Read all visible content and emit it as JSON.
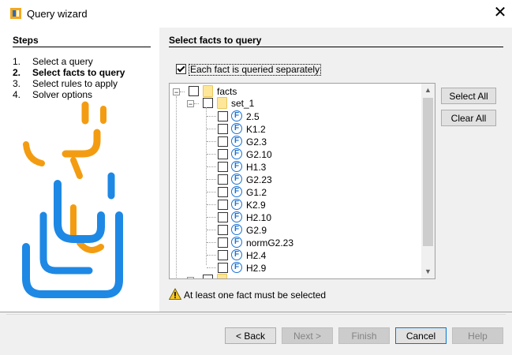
{
  "window": {
    "title": "Query wizard",
    "close_glyph": "✕"
  },
  "steps": {
    "title": "Steps",
    "items": [
      {
        "num": "1.",
        "label": "Select a query",
        "active": false
      },
      {
        "num": "2.",
        "label": "Select facts to query",
        "active": true
      },
      {
        "num": "3.",
        "label": "Select rules to apply",
        "active": false
      },
      {
        "num": "4.",
        "label": "Solver options",
        "active": false
      }
    ]
  },
  "main": {
    "title": "Select facts to query",
    "each_separately": {
      "label": "Each fact is queried separately",
      "checked": true
    },
    "tree": {
      "root": {
        "label": "facts",
        "checked": false,
        "expanded": true
      },
      "group": {
        "label": "set_1",
        "checked": false,
        "expanded": true
      },
      "facts": [
        {
          "label": "2.5",
          "checked": false
        },
        {
          "label": "K1.2",
          "checked": false
        },
        {
          "label": "G2.3",
          "checked": false
        },
        {
          "label": "G2.10",
          "checked": false
        },
        {
          "label": "H1.3",
          "checked": false
        },
        {
          "label": "G2.23",
          "checked": false
        },
        {
          "label": "G1.2",
          "checked": false
        },
        {
          "label": "K2.9",
          "checked": false
        },
        {
          "label": "H2.10",
          "checked": false
        },
        {
          "label": "G2.9",
          "checked": false
        },
        {
          "label": "normG2.23",
          "checked": false
        },
        {
          "label": "H2.4",
          "checked": false
        },
        {
          "label": "H2.9",
          "checked": false
        }
      ],
      "fact_icon_glyph": "F"
    },
    "select_all_label": "Select All",
    "clear_all_label": "Clear All",
    "warning": "At least one fact must be selected"
  },
  "footer": {
    "back_label": "< Back",
    "next_label": "Next >",
    "finish_label": "Finish",
    "cancel_label": "Cancel",
    "help_label": "Help"
  },
  "colors": {
    "fact_icon": "#1a72d4",
    "folder": "#ffe79a",
    "logo_blue": "#1e88e5",
    "logo_orange": "#f39c12"
  }
}
